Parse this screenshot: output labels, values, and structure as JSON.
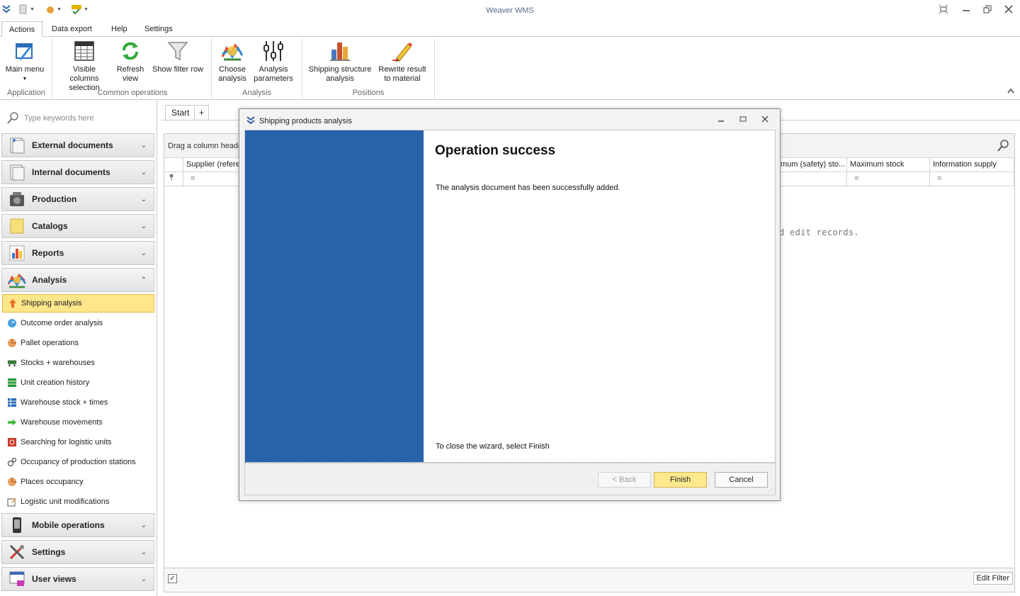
{
  "app": {
    "title": "Weaver WMS"
  },
  "ribbon_tabs": [
    {
      "label": "Actions"
    },
    {
      "label": "Data export"
    },
    {
      "label": "Help"
    },
    {
      "label": "Settings"
    }
  ],
  "ribbon": {
    "main_menu": {
      "line1": "Main menu",
      "line2": ""
    },
    "visible_columns": {
      "line1": "Visible columns",
      "line2": "selection"
    },
    "refresh_view": {
      "line1": "Refresh",
      "line2": "view"
    },
    "show_filter_row": {
      "line1": "Show filter row",
      "line2": ""
    },
    "choose_analysis": {
      "line1": "Choose",
      "line2": "analysis"
    },
    "analysis_parameters": {
      "line1": "Analysis",
      "line2": "parameters"
    },
    "shipping_structure": {
      "line1": "Shipping structure",
      "line2": "analysis"
    },
    "rewrite_result": {
      "line1": "Rewrite result",
      "line2": "to material"
    },
    "groups": {
      "application": "Application",
      "common_operations": "Common operations",
      "analysis": "Analysis",
      "positions": "Positions"
    }
  },
  "sidebar": {
    "search_placeholder": "Type keywords here",
    "groups": {
      "external": "External documents",
      "internal": "Internal documents",
      "production": "Production",
      "catalogs": "Catalogs",
      "reports": "Reports",
      "analysis": "Analysis",
      "mobile": "Mobile operations",
      "settings": "Settings",
      "user_views": "User views"
    },
    "analysis_items": [
      {
        "label": "Shipping analysis"
      },
      {
        "label": "Outcome order analysis"
      },
      {
        "label": "Pallet operations"
      },
      {
        "label": "Stocks + warehouses"
      },
      {
        "label": "Unit creation history"
      },
      {
        "label": "Warehouse stock + times"
      },
      {
        "label": "Warehouse movements"
      },
      {
        "label": "Searching for logistic units"
      },
      {
        "label": "Occupancy of production stations"
      },
      {
        "label": "Places occupancy"
      },
      {
        "label": "Logistic unit modifications"
      }
    ]
  },
  "main": {
    "doc_tab": "Start",
    "add_tab": "+",
    "group_panel_text": "Drag a column heade",
    "columns": {
      "supplier": "Supplier (refere",
      "min_stock": "mum (safety) sto...",
      "max_stock": "Maximum stock",
      "info_supply": "Information supply"
    },
    "filter_symbol": "=",
    "empty_message": "d edit records.",
    "edit_filter": "Edit Filter"
  },
  "dialog": {
    "title": "Shipping products analysis",
    "heading": "Operation success",
    "message": "The analysis document has been successfully added.",
    "close_hint": "To close the wizard, select Finish",
    "back": "< Back",
    "finish": "Finish",
    "cancel": "Cancel"
  },
  "colors": {
    "accent_blue": "#2862a8",
    "selection_yellow": "#fde78a"
  }
}
